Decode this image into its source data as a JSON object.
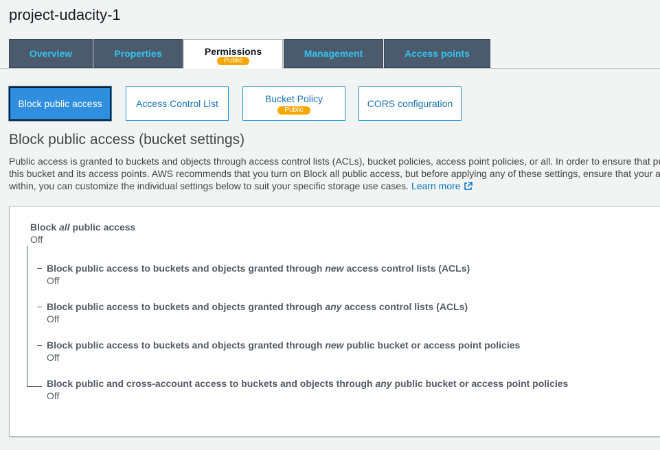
{
  "header": {
    "bucket_name": "project-udacity-1"
  },
  "main_tabs": [
    {
      "label": "Overview"
    },
    {
      "label": "Properties"
    },
    {
      "label": "Permissions",
      "badge": "Public"
    },
    {
      "label": "Management"
    },
    {
      "label": "Access points"
    }
  ],
  "sub_tabs": [
    {
      "label": "Block public access"
    },
    {
      "label": "Access Control List"
    },
    {
      "label": "Bucket Policy",
      "badge": "Public"
    },
    {
      "label": "CORS configuration"
    }
  ],
  "section": {
    "heading": "Block public access (bucket settings)",
    "description_lines": [
      "Public access is granted to buckets and objects through access control lists (ACLs), bucket policies, access point policies, or all. In order to ensure that pu",
      "this bucket and its access points. AWS recommends that you turn on Block all public access, but before applying any of these settings, ensure that your a",
      "within, you can customize the individual settings below to suit your specific storage use cases."
    ],
    "learn_more": "Learn more"
  },
  "settings": {
    "block_all": {
      "prefix": "Block ",
      "emph": "all",
      "suffix": " public access",
      "value": "Off"
    },
    "items": [
      {
        "prefix": "Block public access to buckets and objects granted through ",
        "emph": "new",
        "suffix": " access control lists (ACLs)",
        "value": "Off"
      },
      {
        "prefix": "Block public access to buckets and objects granted through ",
        "emph": "any",
        "suffix": " access control lists (ACLs)",
        "value": "Off"
      },
      {
        "prefix": "Block public access to buckets and objects granted through ",
        "emph": "new",
        "suffix": " public bucket or access point policies",
        "value": "Off"
      },
      {
        "prefix": "Block public and cross-account access to buckets and objects through ",
        "emph": "any",
        "suffix": " public bucket or access point policies",
        "value": "Off"
      }
    ]
  },
  "colors": {
    "tab_bg": "#4b5a6c",
    "tab_text": "#33c3f0",
    "badge": "#f7a600",
    "active_subtab": "#2f8fde",
    "link": "#0073bb"
  },
  "icons": {
    "learn_more": "external-link-icon"
  }
}
